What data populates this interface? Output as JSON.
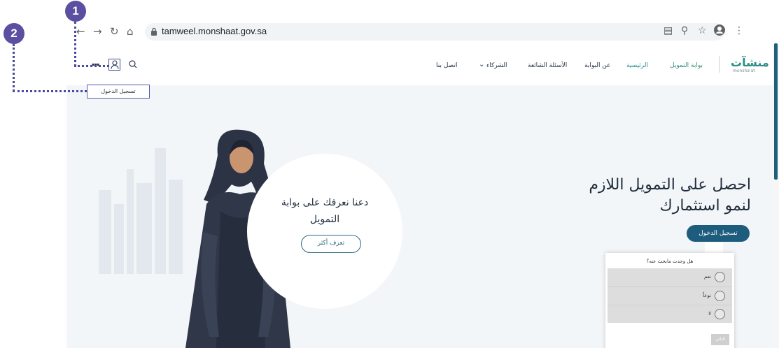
{
  "browser": {
    "url": "tamweel.monshaat.gov.sa",
    "icons": [
      "back-icon",
      "forward-icon",
      "reload-icon",
      "home-icon",
      "lock-icon",
      "translate-icon",
      "zoom-icon",
      "star-icon",
      "profile-icon",
      "menu-icon"
    ]
  },
  "header": {
    "logo": "منشآت",
    "logo_sub": "monsha'at",
    "nav": {
      "portal": "بوابة التمويل",
      "home": "الرئيسية",
      "about": "عن البوابة",
      "faq": "الأسئلة الشائعة",
      "partners": "الشركاء",
      "contact": "اتصل بنا"
    },
    "login_dropdown": "تسجيل الدخول"
  },
  "hero": {
    "title": "احصل على التمويل اللازم لنمو استثمارك",
    "login_button": "تسجيل الدخول"
  },
  "intro": {
    "title": "دعنا نعرفك على بوابة التمويل",
    "button": "تعرف أكثر"
  },
  "survey": {
    "question": "هل وجدت مابحث عنه؟",
    "options": [
      "نعم",
      "نوعاً",
      "لا"
    ],
    "next": "التالي"
  },
  "annotations": {
    "badge1": "1",
    "badge2": "2"
  },
  "colors": {
    "accent": "#1d5c7c",
    "annotation": "#5a4fa0"
  }
}
